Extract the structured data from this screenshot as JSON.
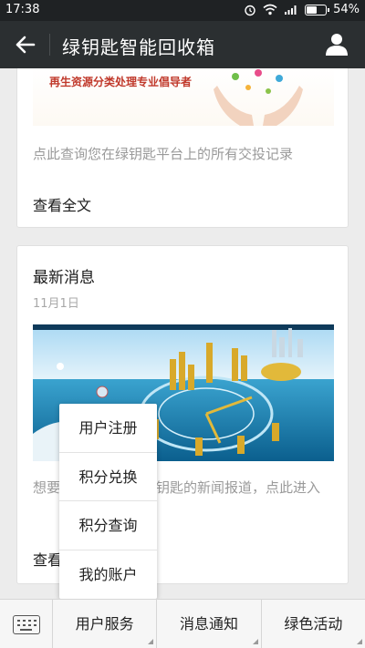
{
  "status": {
    "time": "17:38",
    "battery": "54%"
  },
  "header": {
    "title": "绿钥匙智能回收箱"
  },
  "card1": {
    "banner_slogan": "再生资源分类处理专业倡导者",
    "description": "点此查询您在绿钥匙平台上的所有交投记录",
    "more_label": "查看全文"
  },
  "card2": {
    "heading": "最新消息",
    "date": "11月1日",
    "description": "想要了解更多关于绿钥匙的新闻报道，点此进入",
    "more_label": "查看全文"
  },
  "popup_menu": {
    "items": [
      "用户注册",
      "积分兑换",
      "积分查询",
      "我的账户"
    ]
  },
  "bottom_menu": {
    "tabs": [
      "用户服务",
      "消息通知",
      "绿色活动"
    ]
  }
}
